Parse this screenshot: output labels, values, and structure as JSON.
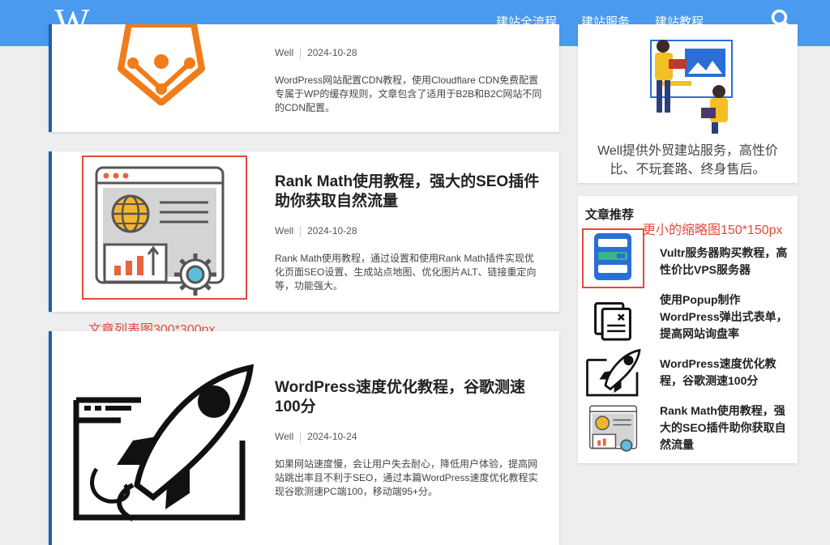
{
  "header": {
    "logo_text": "W",
    "nav": [
      {
        "label": "建站全流程"
      },
      {
        "label": "建站服务"
      },
      {
        "label": "建站教程"
      }
    ],
    "active_nav": "建站教程",
    "search_icon": "search-icon"
  },
  "posts": [
    {
      "author": "Well",
      "date": "2024-10-28",
      "excerpt": "WordPress网站配置CDN教程，使用Cloudflare CDN免费配置专属于WP的缓存规则，文章包含了适用于B2B和B2C网站不同的CDN配置。",
      "icon": "cdn-network-icon"
    },
    {
      "title": "Rank Math使用教程，强大的SEO插件助你获取自然流量",
      "author": "Well",
      "date": "2024-10-28",
      "excerpt": "Rank Math使用教程，通过设置和使用Rank Math插件实现优化页面SEO设置、生成站点地图、优化图片ALT、链接重定向等，功能强大。",
      "icon": "seo-browser-icon"
    },
    {
      "title": "WordPress速度优化教程，谷歌测速100分",
      "author": "Well",
      "date": "2024-10-24",
      "excerpt": "如果网站速度慢，会让用户失去耐心，降低用户体验，提高网站跳出率且不利于SEO，通过本篇WordPress速度优化教程实现谷歌测速PC端100，移动端95+分。",
      "icon": "rocket-browser-icon"
    }
  ],
  "annotations": {
    "list_thumb": "文章列表图300*300px",
    "small_thumb": "更小的缩略图150*150px"
  },
  "sidebar": {
    "promo": {
      "text": "Well提供外贸建站服务，高性价比、不玩套路、终身售后。",
      "icon": "web-designers-illustration"
    },
    "recommended": {
      "heading": "文章推荐",
      "items": [
        {
          "title": "Vultr服务器购买教程，高性价比VPS服务器",
          "icon": "server-icon"
        },
        {
          "title": "使用Popup制作WordPress弹出式表单，提高网站询盘率",
          "icon": "popup-window-icon"
        },
        {
          "title": "WordPress速度优化教程，谷歌测速100分",
          "icon": "rocket-browser-icon"
        },
        {
          "title": "Rank Math使用教程，强大的SEO插件助你获取自然流量",
          "icon": "seo-browser-icon"
        }
      ]
    }
  },
  "colors": {
    "header_bg": "#4a9af0",
    "card_accent": "#1a5fb4",
    "annotation": "#e24a3b",
    "nav_underline": "#2ecc9a"
  }
}
